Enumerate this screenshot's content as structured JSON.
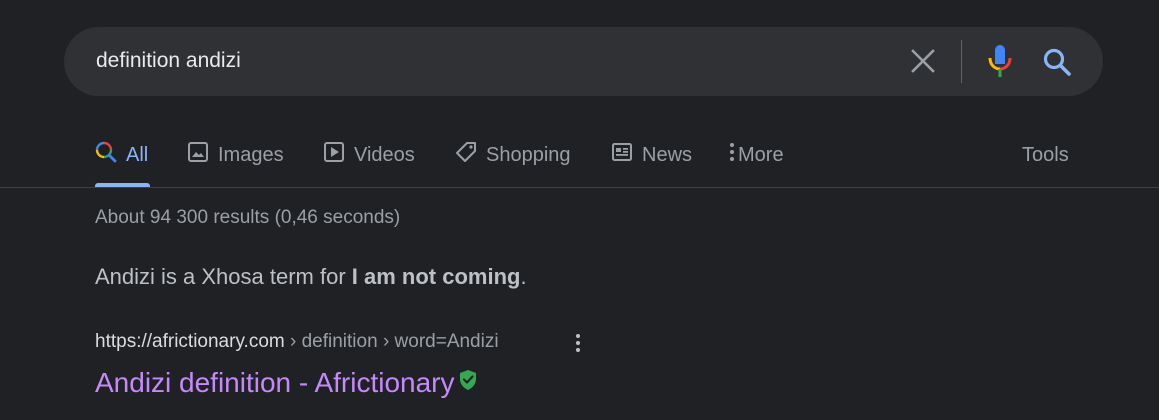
{
  "search": {
    "query": "definition andizi"
  },
  "tabs": [
    {
      "label": "All",
      "icon": "search-multicolor-icon",
      "active": true
    },
    {
      "label": "Images",
      "icon": "image-icon"
    },
    {
      "label": "Videos",
      "icon": "play-icon"
    },
    {
      "label": "Shopping",
      "icon": "tag-icon"
    },
    {
      "label": "News",
      "icon": "newspaper-icon"
    },
    {
      "label": "More",
      "icon": "more-vert-icon"
    }
  ],
  "tools_label": "Tools",
  "result_stats": "About 94 300 results (0,46 seconds)",
  "snippet": {
    "prefix": "Andizi is a Xhosa term for ",
    "bold": "I am not coming",
    "suffix": "."
  },
  "result": {
    "domain": "https://africtionary.com",
    "path": " › definition › word=Andizi",
    "title": "Andizi definition - Africtionary"
  },
  "colors": {
    "background": "#202124",
    "searchbox": "#303134",
    "accent": "#8ab4f8",
    "link_visited": "#c58af9",
    "verified": "#34a853"
  }
}
